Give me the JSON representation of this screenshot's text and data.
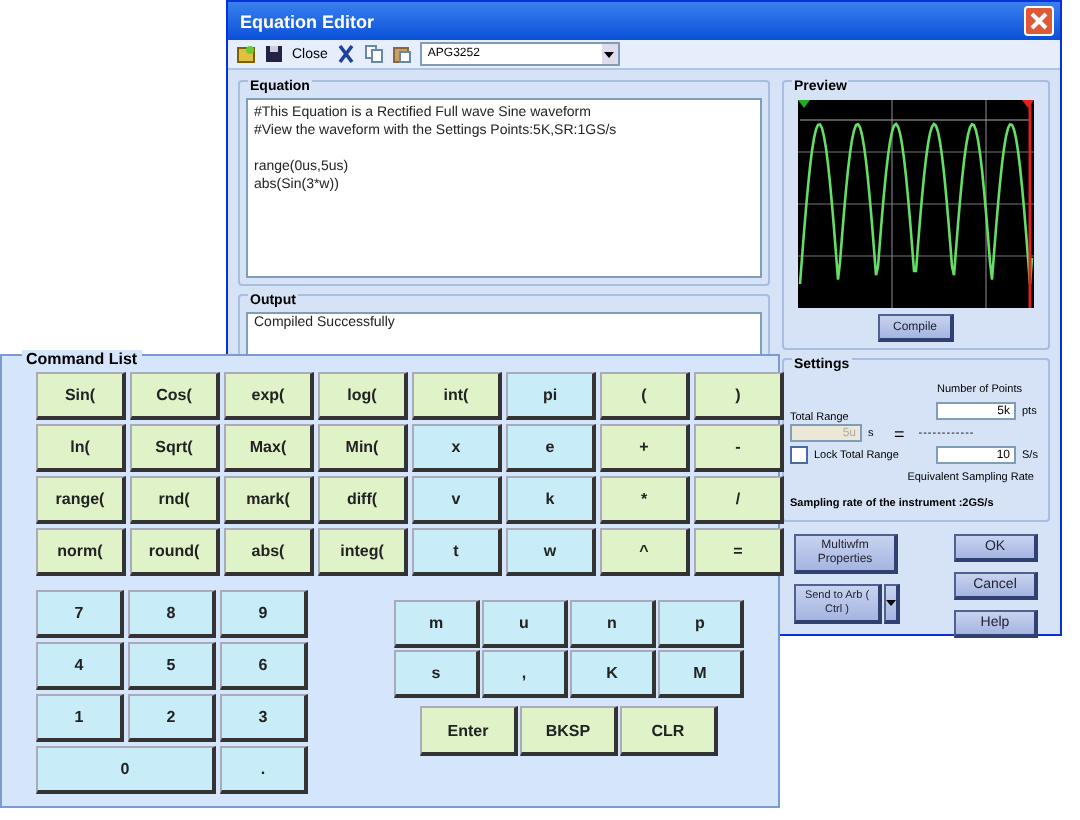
{
  "window": {
    "title": "Equation Editor"
  },
  "toolbar": {
    "close_label": "Close",
    "instrument": "APG3252"
  },
  "equation": {
    "title": "Equation",
    "lines": [
      "#This Equation is a Rectified Full wave Sine waveform",
      "#View the waveform with the Settings Points:5K,SR:1GS/s",
      "range(0us,5us)",
      "abs(Sin(3*w))"
    ]
  },
  "output": {
    "title": "Output",
    "text": "Compiled Successfully"
  },
  "preview": {
    "title": "Preview",
    "compile_button": "Compile"
  },
  "settings": {
    "title": "Settings",
    "points_label": "Number of Points",
    "points_value": "5k",
    "points_unit": "pts",
    "range_label": "Total Range",
    "range_value": "5u",
    "range_unit": "s",
    "equals": "=",
    "divider": "------------",
    "lock_label": "Lock Total Range",
    "lock_checked": false,
    "rate_value": "10",
    "rate_unit": "S/s",
    "rate_label": "Equivalent Sampling Rate",
    "instrument_rate": "Sampling rate of the instrument :2GS/s"
  },
  "buttons": {
    "multiwfm": "Multiwfm Properties",
    "send": "Send to Arb ( Ctrl )",
    "ok": "OK",
    "cancel": "Cancel",
    "help": "Help"
  },
  "command_list": {
    "title": "Command List",
    "functions": [
      {
        "label": "Sin(",
        "kind": "func"
      },
      {
        "label": "Cos(",
        "kind": "func"
      },
      {
        "label": "exp(",
        "kind": "func"
      },
      {
        "label": "log(",
        "kind": "func"
      },
      {
        "label": "int(",
        "kind": "func"
      },
      {
        "label": "pi",
        "kind": "var"
      },
      {
        "label": "(",
        "kind": "func"
      },
      {
        "label": ")",
        "kind": "func"
      },
      {
        "label": "ln(",
        "kind": "func"
      },
      {
        "label": "Sqrt(",
        "kind": "func"
      },
      {
        "label": "Max(",
        "kind": "func"
      },
      {
        "label": "Min(",
        "kind": "func"
      },
      {
        "label": "x",
        "kind": "var"
      },
      {
        "label": "e",
        "kind": "var"
      },
      {
        "label": "+",
        "kind": "func"
      },
      {
        "label": "-",
        "kind": "func"
      },
      {
        "label": "range(",
        "kind": "func"
      },
      {
        "label": "rnd(",
        "kind": "func"
      },
      {
        "label": "mark(",
        "kind": "func"
      },
      {
        "label": "diff(",
        "kind": "func"
      },
      {
        "label": "v",
        "kind": "var"
      },
      {
        "label": "k",
        "kind": "var"
      },
      {
        "label": "*",
        "kind": "func"
      },
      {
        "label": "/",
        "kind": "func"
      },
      {
        "label": "norm(",
        "kind": "func"
      },
      {
        "label": "round(",
        "kind": "func"
      },
      {
        "label": "abs(",
        "kind": "func"
      },
      {
        "label": "integ(",
        "kind": "func"
      },
      {
        "label": "t",
        "kind": "var"
      },
      {
        "label": "w",
        "kind": "var"
      },
      {
        "label": "^",
        "kind": "func"
      },
      {
        "label": "=",
        "kind": "func"
      }
    ],
    "digits": [
      "7",
      "8",
      "9",
      "4",
      "5",
      "6",
      "1",
      "2",
      "3",
      "0",
      "."
    ],
    "units": [
      "m",
      "u",
      "n",
      "p",
      "s",
      ",",
      "K",
      "M"
    ],
    "actions": [
      "Enter",
      "BKSP",
      "CLR"
    ]
  }
}
